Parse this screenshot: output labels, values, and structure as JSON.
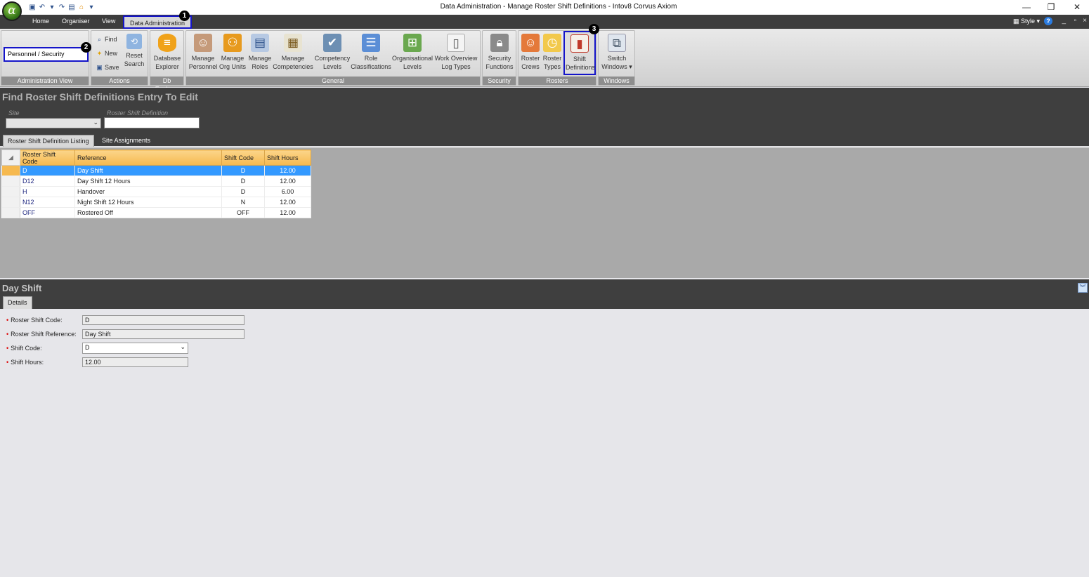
{
  "window": {
    "title": "Data Administration - Manage Roster Shift Definitions - Intov8 Corvus Axiom"
  },
  "logo": {
    "glyph": "α"
  },
  "menu": {
    "items": [
      "Home",
      "Organiser",
      "View",
      "Data Administration"
    ],
    "style_label": "Style"
  },
  "badges": [
    "1",
    "2",
    "3"
  ],
  "ribbon": {
    "admin_view": {
      "value": "Personnel / Security",
      "group_label": "Administration View"
    },
    "actions": {
      "find": "Find",
      "new": "New",
      "save": "Save",
      "reset_line1": "Reset",
      "reset_line2": "Search",
      "group_label": "Actions"
    },
    "db_explorer": {
      "line1": "Database",
      "line2": "Explorer",
      "group_label": "Db Explorer"
    },
    "general": {
      "group_label": "General",
      "buttons": [
        {
          "line1": "Manage",
          "line2": "Personnel"
        },
        {
          "line1": "Manage",
          "line2": "Org Units"
        },
        {
          "line1": "Manage",
          "line2": "Roles"
        },
        {
          "line1": "Manage",
          "line2": "Competencies"
        },
        {
          "line1": "Competency",
          "line2": "Levels"
        },
        {
          "line1": "Role",
          "line2": "Classifications"
        },
        {
          "line1": "Organisational",
          "line2": "Levels"
        },
        {
          "line1": "Work Overview",
          "line2": "Log Types"
        }
      ]
    },
    "security": {
      "line1": "Security",
      "line2": "Functions",
      "group_label": "Security"
    },
    "rosters": {
      "group_label": "Rosters",
      "buttons": [
        {
          "line1": "Roster",
          "line2": "Crews"
        },
        {
          "line1": "Roster",
          "line2": "Types"
        },
        {
          "line1": "Shift",
          "line2": "Definitions"
        }
      ]
    },
    "windows": {
      "line1": "Switch",
      "line2": "Windows ▾",
      "group_label": "Windows"
    }
  },
  "find": {
    "title": "Find Roster Shift Definitions Entry To Edit",
    "site_label": "Site",
    "site_value": "",
    "definition_label": "Roster Shift Definition",
    "definition_value": ""
  },
  "tabs": [
    "Roster Shift Definition Listing",
    "Site Assignments"
  ],
  "grid": {
    "columns": [
      "Roster Shift Code",
      "Reference",
      "Shift Code",
      "Shift Hours"
    ],
    "rows": [
      [
        "D",
        "Day Shift",
        "D",
        "12.00"
      ],
      [
        "D12",
        "Day Shift 12 Hours",
        "D",
        "12.00"
      ],
      [
        "H",
        "Handover",
        "D",
        "6.00"
      ],
      [
        "N12",
        "Night Shift 12 Hours",
        "N",
        "12.00"
      ],
      [
        "OFF",
        "Rostered Off",
        "OFF",
        "12.00"
      ]
    ]
  },
  "detail": {
    "title": "Day Shift",
    "tab": "Details",
    "fields": [
      {
        "label": "Roster Shift Code:",
        "value": "D"
      },
      {
        "label": "Roster Shift Reference:",
        "value": "Day Shift"
      },
      {
        "label": "Shift Code:",
        "value": "D"
      },
      {
        "label": "Shift Hours:",
        "value": "12.00"
      }
    ]
  }
}
